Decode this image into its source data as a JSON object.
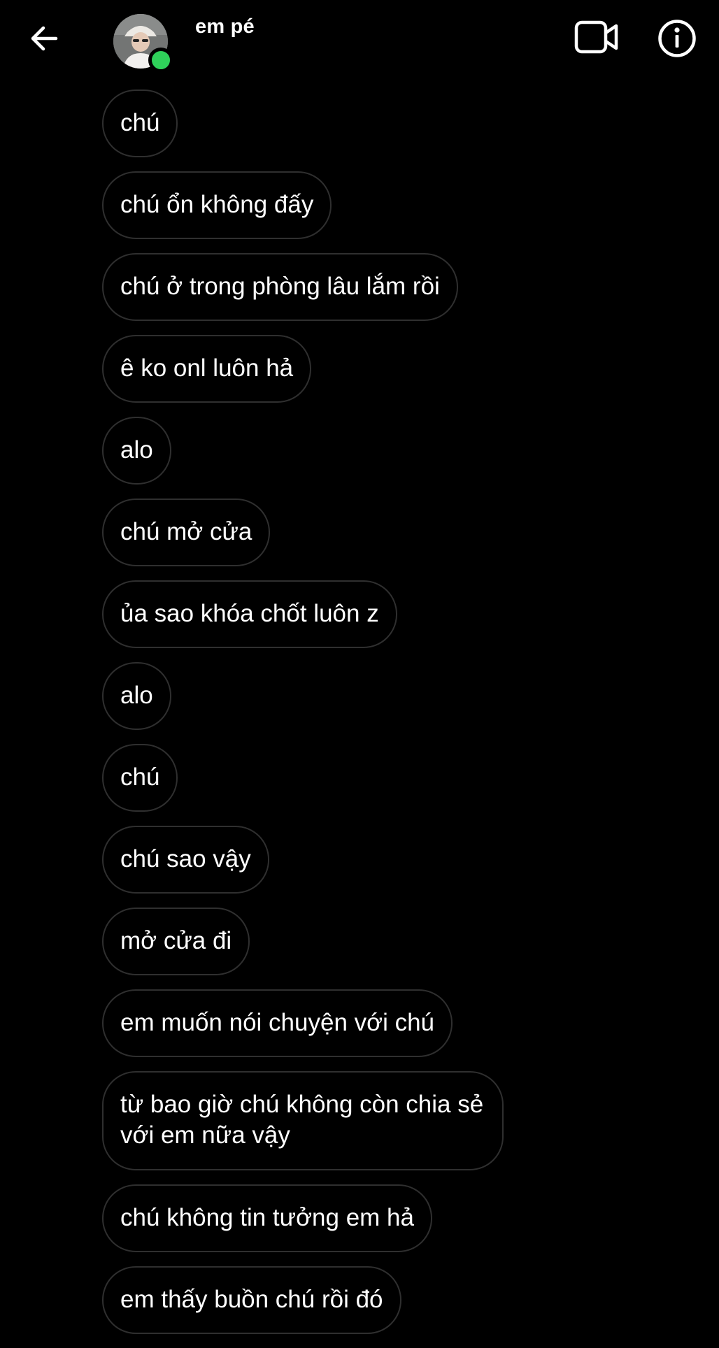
{
  "header": {
    "contact_name": "em pé",
    "online": true,
    "back_icon": "arrow-left-icon",
    "video_icon": "video-camera-icon",
    "info_icon": "info-icon",
    "online_color": "#2fd15a"
  },
  "messages": [
    {
      "text": "chú"
    },
    {
      "text": "chú ổn không đấy"
    },
    {
      "text": "chú ở trong phòng lâu lắm rồi"
    },
    {
      "text": "ê ko onl luôn hả"
    },
    {
      "text": "alo"
    },
    {
      "text": "chú mở cửa"
    },
    {
      "text": "ủa sao khóa chốt luôn z"
    },
    {
      "text": "alo"
    },
    {
      "text": "chú"
    },
    {
      "text": "chú sao vậy"
    },
    {
      "text": "mở cửa đi"
    },
    {
      "text": "em muốn nói chuyện với chú"
    },
    {
      "text": "từ bao giờ chú không còn chia sẻ với em nữa vậy"
    },
    {
      "text": "chú không tin tưởng em hả"
    },
    {
      "text": "em thấy buồn chú rồi đó"
    }
  ],
  "colors": {
    "background": "#000000",
    "bubble_border": "#2f2f2f",
    "text": "#ffffff"
  }
}
